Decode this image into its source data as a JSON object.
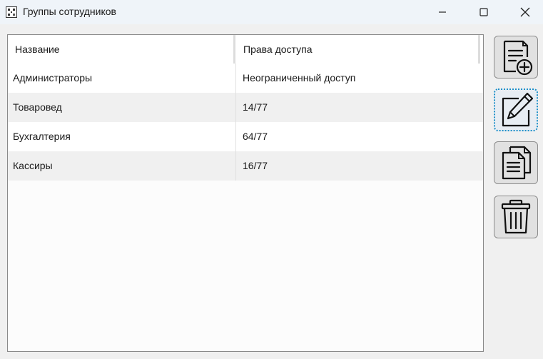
{
  "window": {
    "title": "Группы сотрудников",
    "app_icon": "grid-app-icon",
    "controls": [
      "minimize-icon",
      "maximize-icon",
      "close-icon"
    ]
  },
  "table": {
    "columns": [
      "Название",
      "Права доступа"
    ],
    "rows": [
      [
        "Администраторы",
        "Неограниченный доступ"
      ],
      [
        "Товаровед",
        "14/77"
      ],
      [
        "Бухгалтерия",
        "64/77"
      ],
      [
        "Кассиры",
        "16/77"
      ]
    ]
  },
  "toolbar": {
    "buttons": [
      {
        "icon": "add-document-icon"
      },
      {
        "icon": "edit-document-icon",
        "focused": true
      },
      {
        "icon": "copy-document-icon"
      },
      {
        "icon": "trash-icon"
      }
    ]
  },
  "colors": {
    "titlebar": "#eff4f9",
    "focus_border": "#1e90c8",
    "row_alt": "#f0f0f0"
  }
}
